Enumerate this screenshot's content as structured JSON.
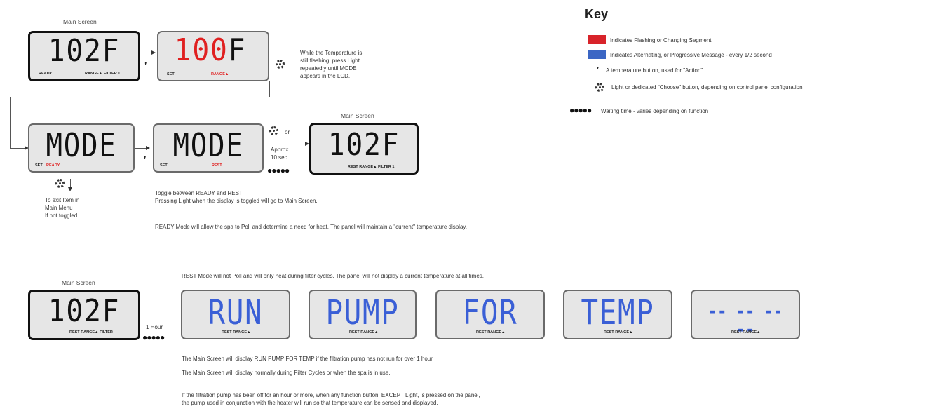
{
  "key": {
    "title": "Key",
    "items": [
      {
        "icon": "red-swatch",
        "text": "Indicates Flashing or Changing Segment",
        "color": "#d8232a"
      },
      {
        "icon": "blue-swatch",
        "text": "Indicates Alternating, or Progressive Message - every 1/2 second",
        "color": "#3b66c4"
      },
      {
        "icon": "hand-icon",
        "text": "A temperature button, used for \"Action\""
      },
      {
        "icon": "gear-icon",
        "text": "Light or dedicated \"Choose\" button, depending on control panel configuration"
      },
      {
        "icon": "dots",
        "text": "Waiting time - varies depending on function"
      }
    ]
  },
  "row1": {
    "main_label": "Main Screen",
    "lcd1": {
      "big": "102F",
      "left": "READY",
      "right": "RANGE▲ FILTER 1"
    },
    "lcd2": {
      "big_red": "100",
      "big_rest": "F",
      "left": "SET",
      "right": "RANGE▲"
    },
    "note": [
      "While the Temperature is",
      "still flashing, press Light",
      "repeatedly until MODE",
      "appears in the LCD."
    ]
  },
  "row2": {
    "lcd3": {
      "big": "MODE",
      "left": "SET",
      "right": "READY"
    },
    "lcd4": {
      "big": "MODE",
      "left": "SET",
      "right": "REST"
    },
    "or": "or",
    "approx": [
      "Approx.",
      "10 sec."
    ],
    "main_label": "Main Screen",
    "lcd5": {
      "big": "102F",
      "right": "REST RANGE▲ FILTER 1"
    },
    "exit_note": [
      "To exit Item in",
      "Main Menu",
      "If not toggled"
    ],
    "toggle_note": [
      "Toggle between READY and REST",
      "Pressing Light when the display is toggled will go to Main Screen."
    ],
    "ready_note": "READY Mode will allow the spa to Poll and determine a need for heat. The panel will maintain a \"current\" temperature display."
  },
  "row3": {
    "rest_note": "REST Mode will not Poll and will only heat during filter cycles. The panel will not display a current temperature at all times.",
    "main_label": "Main Screen",
    "lcd": {
      "big": "102F",
      "right": "REST RANGE▲ FILTER"
    },
    "hour": "1 Hour",
    "words": [
      {
        "big": "RUN",
        "small": "REST RANGE▲"
      },
      {
        "big": "PUMP",
        "small": "REST RANGE▲"
      },
      {
        "big": "FOR",
        "small": "REST RANGE▲"
      },
      {
        "big": "TEMP",
        "small": "REST RANGE▲"
      },
      {
        "big": "-- -- -- --",
        "small": "REST RANGE▲"
      }
    ],
    "notes": [
      "The Main Screen will display RUN PUMP FOR TEMP if the filtration pump has not run for over 1 hour.",
      "The Main Screen will display normally during Filter Cycles or when the spa is in use."
    ],
    "final_note": [
      "If the filtration pump has been off for an hour or more, when any function button, EXCEPT Light, is pressed on the panel,",
      "the pump used in conjunction with the heater will run so that temperature can be sensed and displayed."
    ]
  }
}
